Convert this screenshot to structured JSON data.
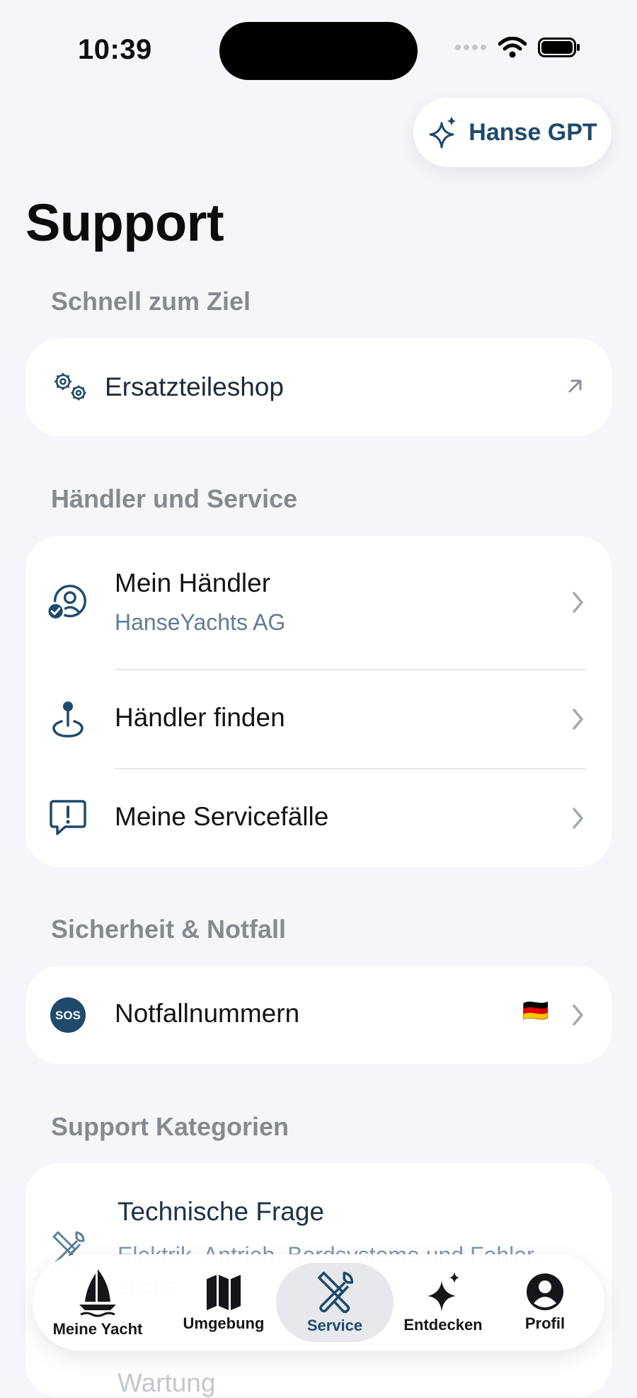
{
  "status_bar": {
    "time": "10:39"
  },
  "assistant_button": {
    "label": "Hanse GPT",
    "icon": "sparkles-icon"
  },
  "page": {
    "title": "Support"
  },
  "sections": {
    "quick": {
      "heading": "Schnell zum Ziel",
      "items": [
        {
          "label": "Ersatzteileshop",
          "icon": "gears-icon",
          "trailing_icon": "external-arrow-icon"
        }
      ]
    },
    "dealer": {
      "heading": "Händler und Service",
      "items": [
        {
          "label": "Mein Händler",
          "sublabel": "HanseYachts AG",
          "icon": "dealer-verified-icon"
        },
        {
          "label": "Händler finden",
          "icon": "location-pin-icon"
        },
        {
          "label": "Meine Servicefälle",
          "icon": "alert-bubble-icon"
        }
      ]
    },
    "safety": {
      "heading": "Sicherheit & Notfall",
      "items": [
        {
          "label": "Notfallnummern",
          "icon": "sos-icon",
          "icon_text": "SOS",
          "badge": "🇩🇪"
        }
      ]
    },
    "categories": {
      "heading": "Support Kategorien",
      "items": [
        {
          "label": "Technische Frage",
          "sublabel": "Elektrik, Antrieb, Bordsysteme und Fehler-suche.",
          "icon": "tools-icon"
        },
        {
          "label": "Wartung"
        }
      ]
    }
  },
  "tabbar": {
    "items": [
      {
        "label": "Meine Yacht",
        "icon": "sailboat-icon"
      },
      {
        "label": "Umgebung",
        "icon": "map-icon"
      },
      {
        "label": "Service",
        "icon": "tools-icon",
        "active": true
      },
      {
        "label": "Entdecken",
        "icon": "sparkles-icon"
      },
      {
        "label": "Profil",
        "icon": "person-icon"
      }
    ]
  },
  "colors": {
    "accent": "#1f4a6c",
    "subtext": "#5f7d98",
    "background": "#f5f6f9"
  }
}
